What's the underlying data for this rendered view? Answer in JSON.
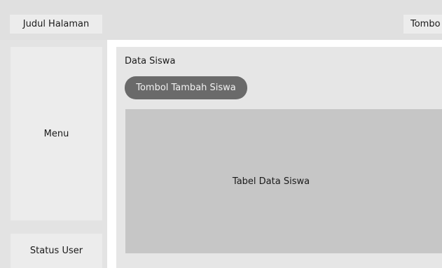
{
  "header": {
    "page_title": "Judul Halaman",
    "top_right_button": "Tombo"
  },
  "sidebar": {
    "menu_label": "Menu",
    "status_label": "Status User"
  },
  "main": {
    "section_title": "Data Siswa",
    "add_button_label": "Tombol Tambah Siswa",
    "table_label": "Tabel Data Siswa"
  }
}
